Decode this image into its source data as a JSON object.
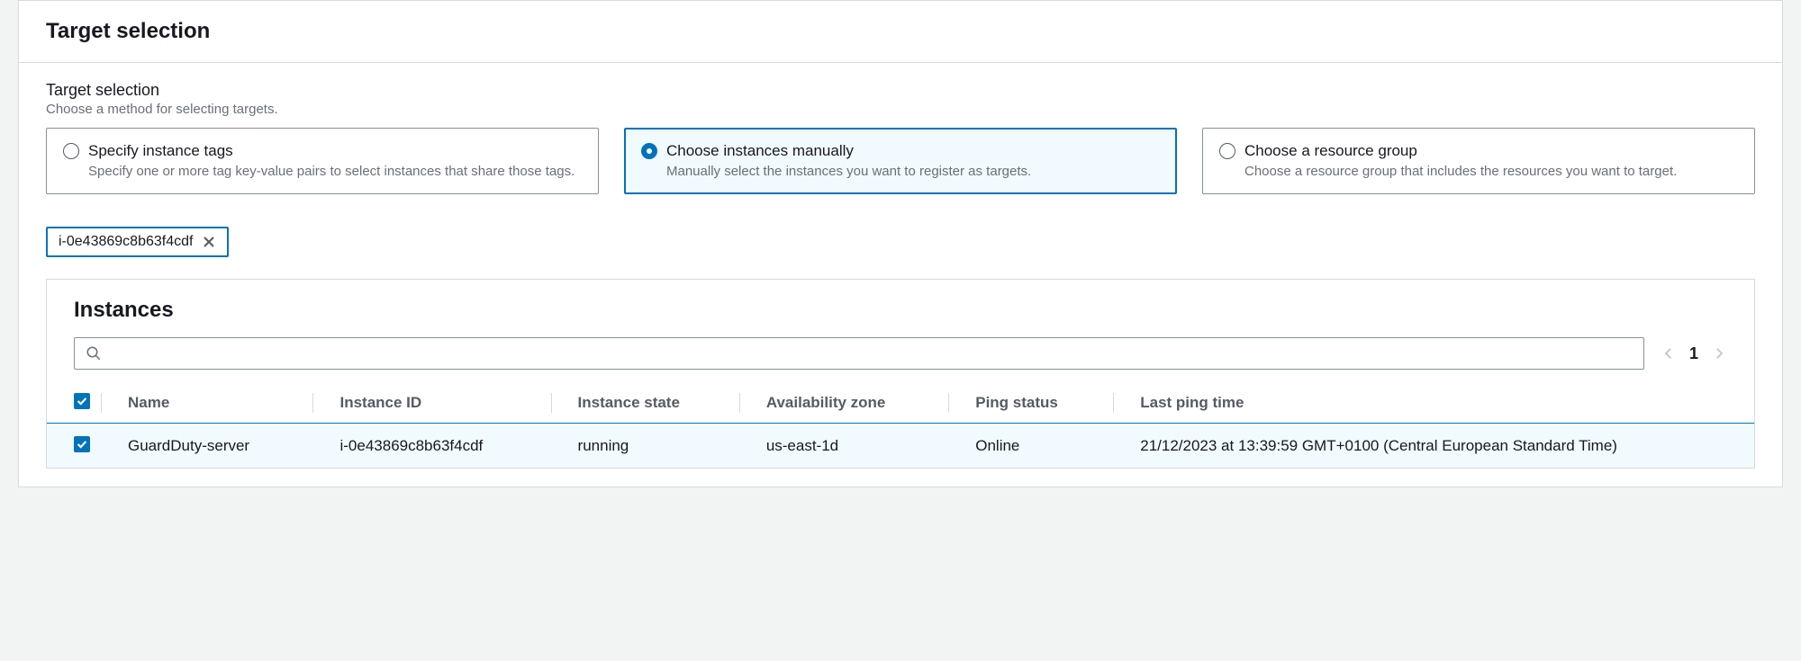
{
  "panel": {
    "title": "Target selection",
    "section_label": "Target selection",
    "section_desc": "Choose a method for selecting targets."
  },
  "options": [
    {
      "title": "Specify instance tags",
      "desc": "Specify one or more tag key-value pairs to select instances that share those tags.",
      "selected": false
    },
    {
      "title": "Choose instances manually",
      "desc": "Manually select the instances you want to register as targets.",
      "selected": true
    },
    {
      "title": "Choose a resource group",
      "desc": "Choose a resource group that includes the resources you want to target.",
      "selected": false
    }
  ],
  "chips": [
    "i-0e43869c8b63f4cdf"
  ],
  "instances": {
    "title": "Instances",
    "search_placeholder": "",
    "page": "1",
    "columns": [
      "Name",
      "Instance ID",
      "Instance state",
      "Availability zone",
      "Ping status",
      "Last ping time"
    ],
    "rows": [
      {
        "checked": true,
        "name": "GuardDuty-server",
        "id": "i-0e43869c8b63f4cdf",
        "state": "running",
        "az": "us-east-1d",
        "ping": "Online",
        "last": "21/12/2023 at 13:39:59 GMT+0100 (Central European Standard Time)"
      }
    ]
  }
}
